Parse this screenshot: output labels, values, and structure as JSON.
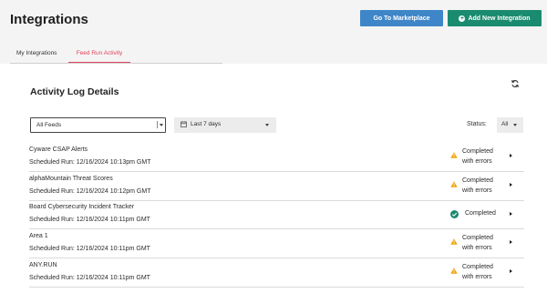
{
  "header": {
    "title": "Integrations",
    "marketplace_button": "Go To Marketplace",
    "add_button": "Add New Integration"
  },
  "tabs": [
    {
      "label": "My Integrations",
      "active": false
    },
    {
      "label": "Feed Run Activity",
      "active": true
    }
  ],
  "section": {
    "title": "Activity Log Details"
  },
  "filters": {
    "feeds_selected": "All Feeds",
    "date_selected": "Last 7 days",
    "status_label": "Status:",
    "status_selected": "All"
  },
  "rows": [
    {
      "name": "Cyware CSAP Alerts",
      "schedule": "Scheduled Run: 12/16/2024 10:13pm GMT",
      "status_line1": "Completed",
      "status_line2": "with errors",
      "status_icon": "warning-icon"
    },
    {
      "name": "alphaMountain Threat Scores",
      "schedule": "Scheduled Run: 12/16/2024 10:12pm GMT",
      "status_line1": "Completed",
      "status_line2": "with errors",
      "status_icon": "warning-icon"
    },
    {
      "name": "Board Cybersecurity Incident Tracker",
      "schedule": "Scheduled Run: 12/16/2024 10:11pm GMT",
      "status_line1": "Completed",
      "status_line2": "",
      "status_icon": "check-circle-icon"
    },
    {
      "name": "Area 1",
      "schedule": "Scheduled Run: 12/16/2024 10:11pm GMT",
      "status_line1": "Completed",
      "status_line2": "with errors",
      "status_icon": "warning-icon"
    },
    {
      "name": "ANY.RUN",
      "schedule": "Scheduled Run: 12/16/2024 10:11pm GMT",
      "status_line1": "Completed",
      "status_line2": "with errors",
      "status_icon": "warning-icon"
    }
  ],
  "colors": {
    "primary_blue": "#3f86c9",
    "accent_green": "#1a8b6f",
    "active_tab": "#e0455a",
    "warning": "#f0a30a",
    "success": "#1a8b6f"
  }
}
